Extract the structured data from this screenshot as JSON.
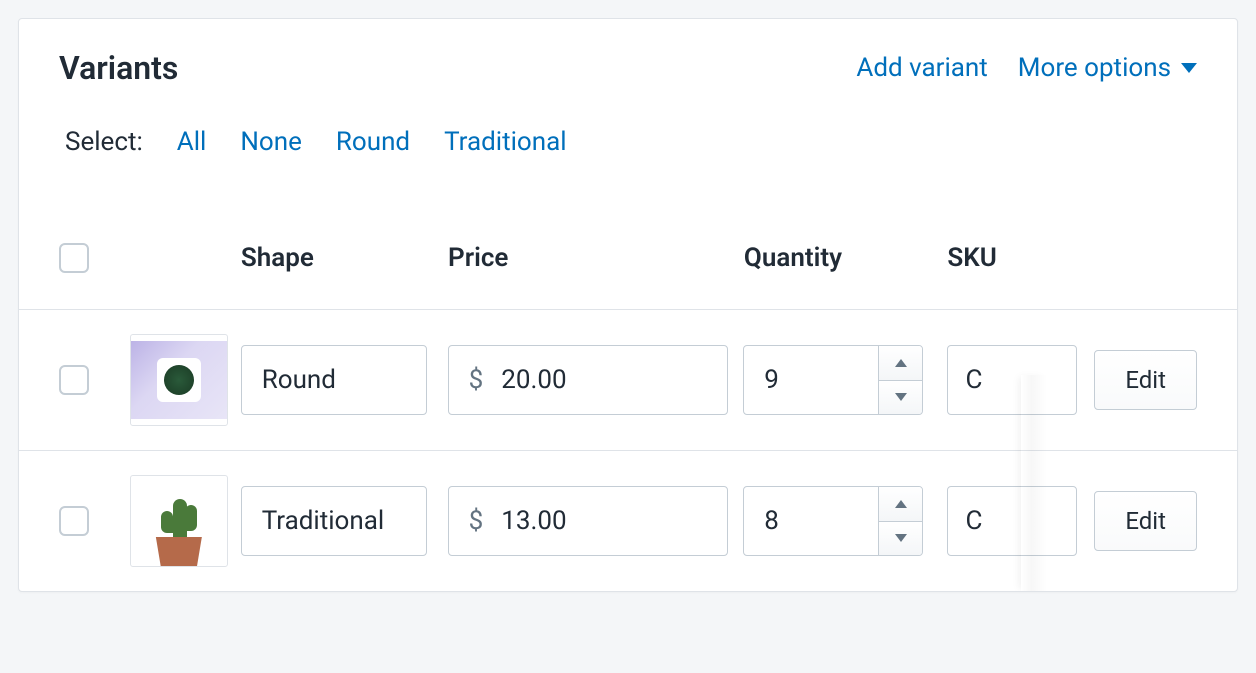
{
  "header": {
    "title": "Variants",
    "add_variant": "Add variant",
    "more_options": "More options"
  },
  "select": {
    "label": "Select:",
    "filters": [
      "All",
      "None",
      "Round",
      "Traditional"
    ]
  },
  "columns": {
    "shape": "Shape",
    "price": "Price",
    "quantity": "Quantity",
    "sku": "SKU"
  },
  "currency_symbol": "$",
  "edit_label": "Edit",
  "rows": [
    {
      "shape": "Round",
      "price": "20.00",
      "quantity": "9",
      "sku": "C",
      "thumb": "round"
    },
    {
      "shape": "Traditional",
      "price": "13.00",
      "quantity": "8",
      "sku": "C",
      "thumb": "traditional"
    }
  ]
}
